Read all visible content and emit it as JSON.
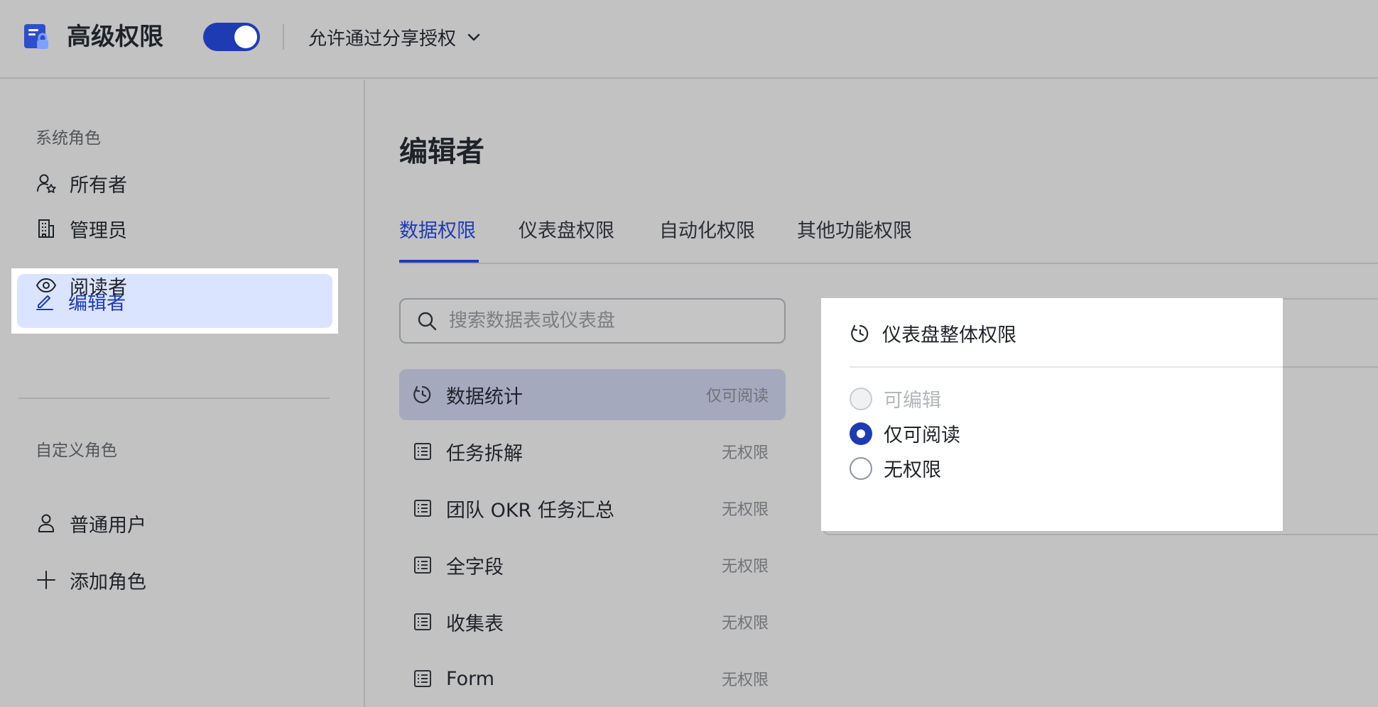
{
  "header": {
    "title": "高级权限",
    "toggle_on": true,
    "share_mode": "允许通过分享授权"
  },
  "sidebar": {
    "system_roles_label": "系统角色",
    "system_roles": [
      {
        "label": "所有者",
        "icon": "owner-icon"
      },
      {
        "label": "管理员",
        "icon": "building-icon"
      },
      {
        "label": "编辑者",
        "icon": "edit-icon",
        "active": true
      },
      {
        "label": "阅读者",
        "icon": "eye-icon"
      }
    ],
    "custom_roles_label": "自定义角色",
    "custom_roles": [
      {
        "label": "普通用户",
        "icon": "user-icon"
      },
      {
        "label": "添加角色",
        "icon": "plus-icon"
      }
    ]
  },
  "main": {
    "title": "编辑者",
    "tabs": [
      {
        "label": "数据权限",
        "active": true
      },
      {
        "label": "仪表盘权限"
      },
      {
        "label": "自动化权限"
      },
      {
        "label": "其他功能权限"
      }
    ],
    "search_placeholder": "搜索数据表或仪表盘",
    "items": [
      {
        "name": "数据统计",
        "permission": "仅可阅读",
        "icon": "dashboard-icon",
        "selected": true
      },
      {
        "name": "任务拆解",
        "permission": "无权限",
        "icon": "table-icon"
      },
      {
        "name": "团队 OKR 任务汇总",
        "permission": "无权限",
        "icon": "table-icon"
      },
      {
        "name": "全字段",
        "permission": "无权限",
        "icon": "table-icon"
      },
      {
        "name": "收集表",
        "permission": "无权限",
        "icon": "table-icon"
      },
      {
        "name": "Form",
        "permission": "无权限",
        "icon": "table-icon"
      }
    ]
  },
  "panel": {
    "title": "仪表盘整体权限",
    "options": [
      {
        "label": "可编辑",
        "state": "disabled"
      },
      {
        "label": "仅可阅读",
        "state": "checked"
      },
      {
        "label": "无权限",
        "state": "unchecked"
      }
    ]
  },
  "colors": {
    "accent": "#1f3bb3",
    "active_bg": "#dbe4ff",
    "selected_row_bg": "#a5a9be",
    "overlay_bg": "#c2c2c2"
  }
}
